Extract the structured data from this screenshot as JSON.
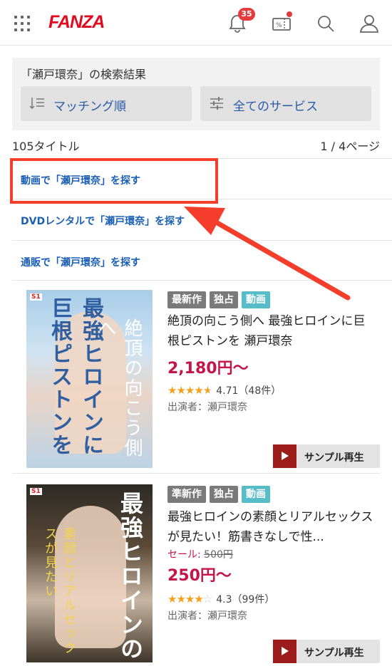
{
  "header": {
    "logo": "FANZA",
    "notification_count": "35"
  },
  "search": {
    "result_label": "「瀬戸環奈」の検索結果",
    "sort_label": "マッチング順",
    "service_label": "全てのサービス"
  },
  "summary": {
    "count": "105タイトル",
    "pages": "1 / 4ページ"
  },
  "links": [
    {
      "label": "動画で「瀬戸環奈」を探す"
    },
    {
      "label": "DVDレンタルで「瀬戸環奈」を探す"
    },
    {
      "label": "通販で「瀬戸環奈」を探す"
    }
  ],
  "items": [
    {
      "tags": [
        "最新作",
        "独占",
        "動画"
      ],
      "title": "絶頂の向こう側へ 最強ヒロインに巨根ピストンを 瀬戸環奈",
      "price": "2,180円〜",
      "rating": "4.71（48件）",
      "stars": 4.71,
      "cast": "出演者：瀬戸環奈",
      "sample_label": "サンプル再生",
      "cover_text_1": "最強ヒロインに巨根ピストンを",
      "cover_text_2": "絶頂の向こう側へ"
    },
    {
      "tags": [
        "準新作",
        "独占",
        "動画"
      ],
      "title": "最強ヒロインの素顔とリアルセックスが見たい！筋書きなしで性...",
      "sale_label": "セール:",
      "old_price": "500円",
      "price": "250円〜",
      "rating": "4.3（99件）",
      "stars": 4.3,
      "cast": "出演者：瀬戸環奈",
      "sample_label": "サンプル再生",
      "cover_text_1": "最強ヒロインの",
      "cover_text_2": "素顔とリアルセックスが見たい"
    }
  ],
  "colors": {
    "brand": "#e10a1e",
    "link": "#1b5fb5",
    "price": "#c5144a",
    "annotation": "#f53d2b"
  }
}
